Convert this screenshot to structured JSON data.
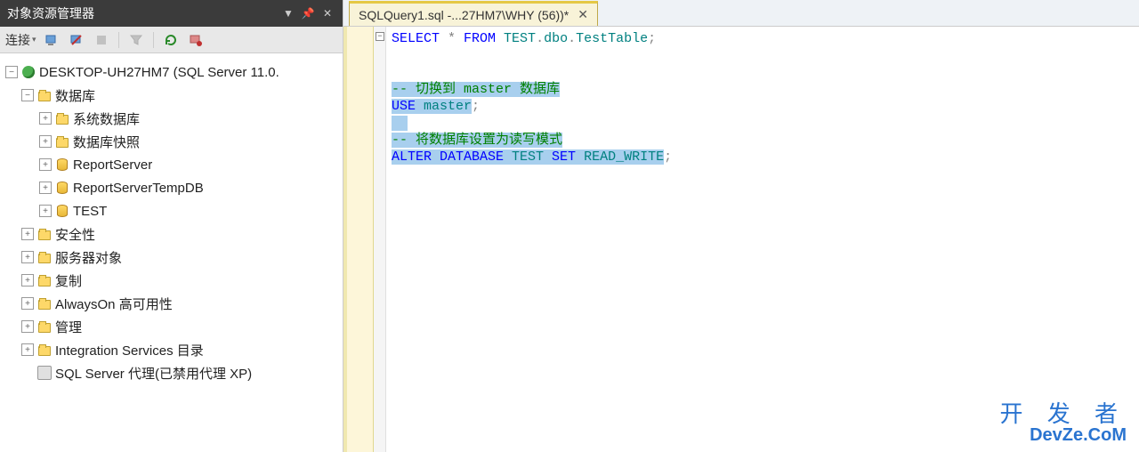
{
  "panel": {
    "title": "对象资源管理器",
    "connect_label": "连接"
  },
  "tree": {
    "server": "DESKTOP-UH27HM7 (SQL Server 11.0.",
    "databases": "数据库",
    "sysdb": "系统数据库",
    "snapshot": "数据库快照",
    "reportserver": "ReportServer",
    "reportservertemp": "ReportServerTempDB",
    "test": "TEST",
    "security": "安全性",
    "serverobj": "服务器对象",
    "replication": "复制",
    "alwayson": "AlwaysOn 高可用性",
    "management": "管理",
    "integration": "Integration Services 目录",
    "agent": "SQL Server 代理(已禁用代理 XP)"
  },
  "tab": {
    "title": "SQLQuery1.sql -...27HM7\\WHY (56))*"
  },
  "code": {
    "l1a": "SELECT",
    "l1b": " * ",
    "l1c": "FROM",
    "l1d": " TEST",
    "l1e": ".",
    "l1f": "dbo",
    "l1g": ".",
    "l1h": "TestTable",
    "l1i": ";",
    "c1": "-- 切换到 master 数据库",
    "l4a": "USE",
    "l4b": " master",
    "l4c": ";",
    "c2": "-- 将数据库设置为读写模式",
    "l7a": "ALTER",
    "l7b": " DATABASE",
    "l7c": " TEST ",
    "l7d": "SET",
    "l7e": " READ_WRITE",
    "l7f": ";"
  },
  "watermark": {
    "line1": "开 发 者",
    "line2": "DevZe.CoM"
  }
}
